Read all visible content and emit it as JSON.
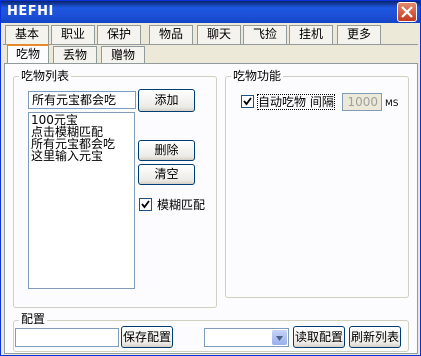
{
  "window": {
    "title": "HEFHI"
  },
  "tabs_row1": [
    {
      "label": "基本"
    },
    {
      "label": "职业"
    },
    {
      "label": "保护"
    },
    {
      "label": "物品"
    },
    {
      "label": "聊天"
    },
    {
      "label": "飞捡"
    },
    {
      "label": "挂机"
    },
    {
      "label": "更多"
    }
  ],
  "tabs_row2": [
    {
      "label": "吃物"
    },
    {
      "label": "丢物"
    },
    {
      "label": "赠物"
    }
  ],
  "eat_list_group": {
    "label": "吃物列表",
    "input_value": "所有元宝都会吃",
    "add_button": "添加",
    "delete_button": "删除",
    "clear_button": "清空",
    "fuzzy_match_label": "模糊匹配",
    "items": [
      "100元宝",
      "点击模糊匹配",
      "所有元宝都会吃",
      "这里输入元宝"
    ]
  },
  "eat_func_group": {
    "label": "吃物功能",
    "auto_eat_label": "自动吃物 间隔",
    "interval_value": "1000",
    "interval_unit": "MS"
  },
  "config_group": {
    "label": "配置",
    "config_input_value": "",
    "save_button": "保存配置",
    "config_select_value": "",
    "load_button": "读取配置",
    "refresh_button": "刷新列表"
  }
}
